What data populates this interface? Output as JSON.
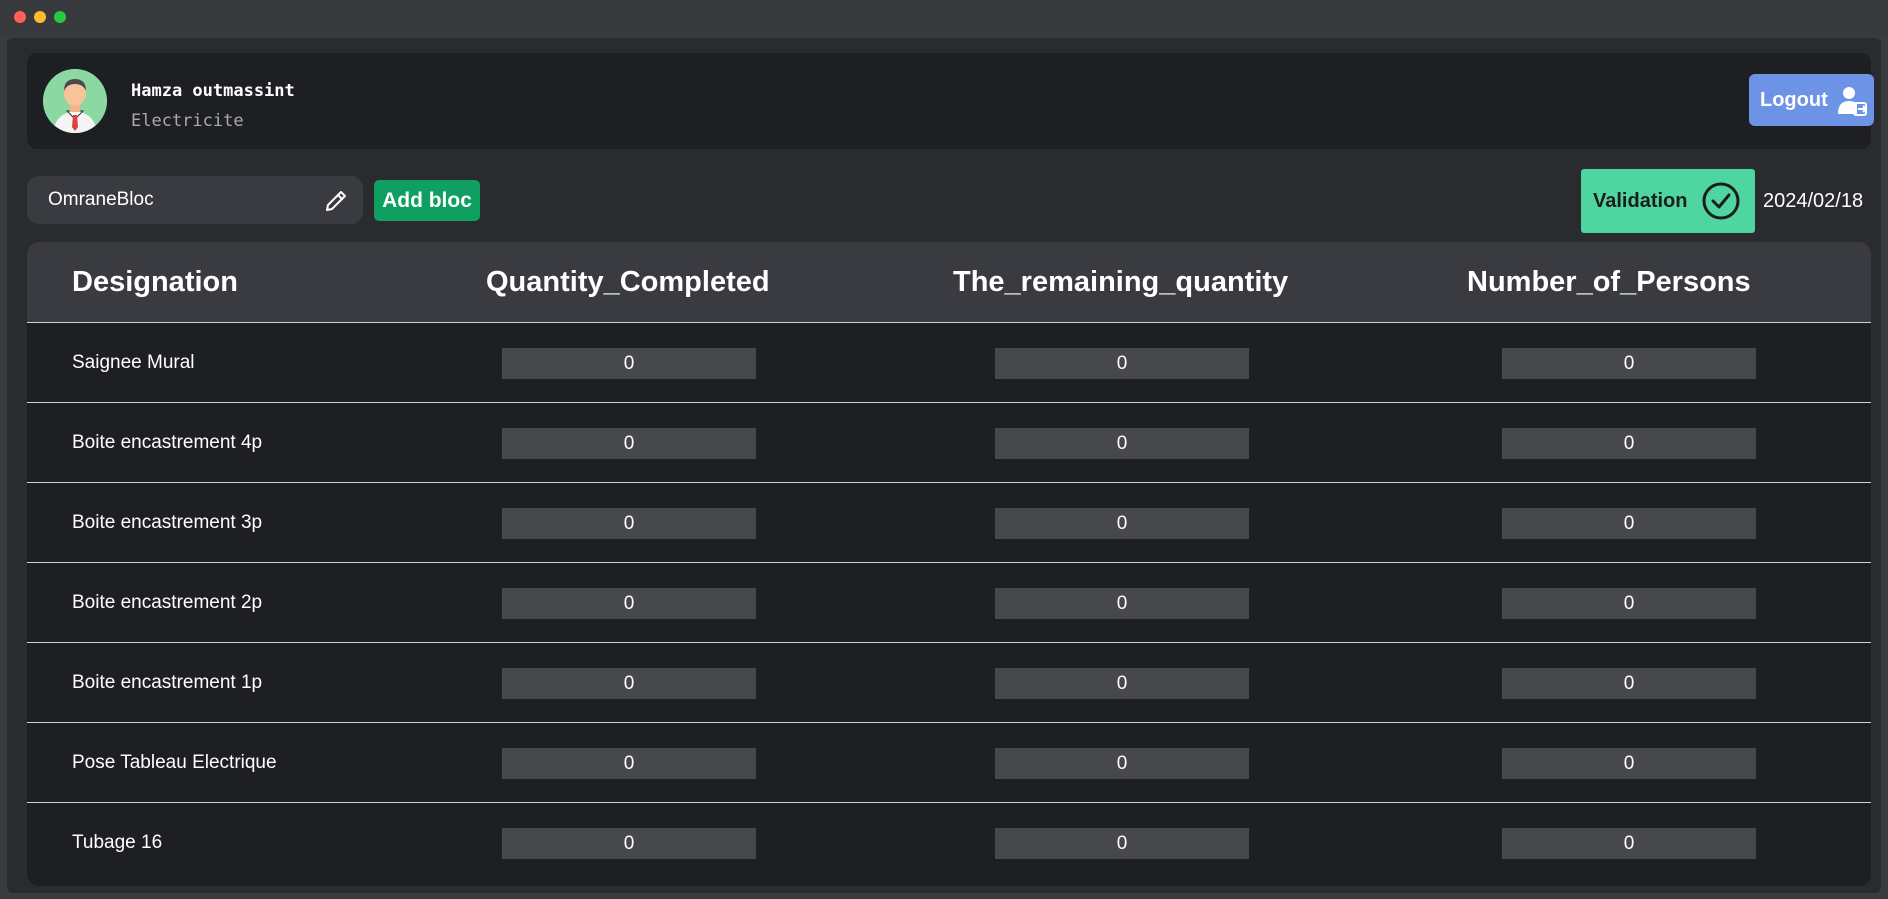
{
  "user": {
    "name": "Hamza outmassint",
    "role": "Electricite"
  },
  "header": {
    "logout_label": "Logout"
  },
  "toolbar": {
    "bloc_value": "OmraneBloc",
    "add_bloc_label": "Add bloc",
    "validation_label": "Validation",
    "date": "2024/02/18"
  },
  "table": {
    "columns": [
      "Designation",
      "Quantity_Completed",
      "The_remaining_quantity",
      "Number_of_Persons"
    ],
    "rows": [
      {
        "designation": "Saignee Mural",
        "quantity_completed": "0",
        "remaining_quantity": "0",
        "number_of_persons": "0"
      },
      {
        "designation": "Boite encastrement 4p",
        "quantity_completed": "0",
        "remaining_quantity": "0",
        "number_of_persons": "0"
      },
      {
        "designation": "Boite encastrement 3p",
        "quantity_completed": "0",
        "remaining_quantity": "0",
        "number_of_persons": "0"
      },
      {
        "designation": "Boite encastrement 2p",
        "quantity_completed": "0",
        "remaining_quantity": "0",
        "number_of_persons": "0"
      },
      {
        "designation": "Boite encastrement 1p",
        "quantity_completed": "0",
        "remaining_quantity": "0",
        "number_of_persons": "0"
      },
      {
        "designation": "Pose Tableau Electrique",
        "quantity_completed": "0",
        "remaining_quantity": "0",
        "number_of_persons": "0"
      },
      {
        "designation": "Tubage 16",
        "quantity_completed": "0",
        "remaining_quantity": "0",
        "number_of_persons": "0"
      }
    ]
  },
  "colors": {
    "logout": "#6c93e6",
    "add_bloc": "#0e9f61",
    "validation": "#4fd6a0",
    "panel": "#1e1f23"
  },
  "icons": {
    "avatar": "businessman-avatar-icon",
    "logout": "user-logout-icon",
    "edit": "pencil-icon",
    "validation": "check-circle-icon"
  }
}
